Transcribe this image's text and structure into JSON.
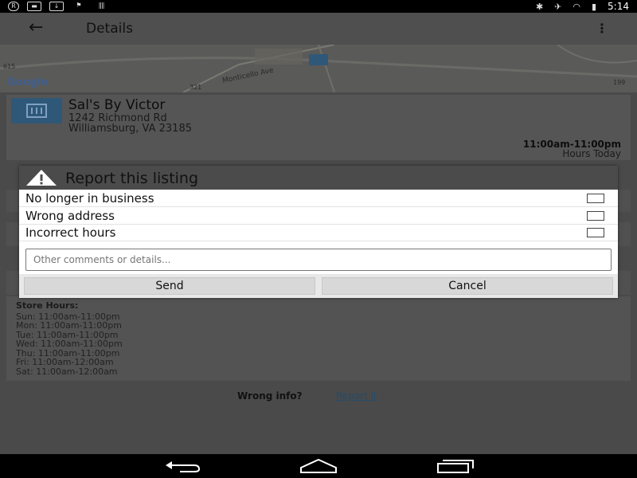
{
  "status_bar": {
    "time": "5:14",
    "icons": [
      "r-badge-icon",
      "message-icon",
      "download-icon",
      "flag-icon",
      "barcode-icon",
      "bluetooth-icon",
      "airplane-icon",
      "wifi-icon",
      "battery-icon"
    ]
  },
  "app_bar": {
    "title": "Details"
  },
  "map": {
    "brand": "Google",
    "road_labels": [
      "Monticello Ave",
      "321",
      "615",
      "199"
    ]
  },
  "listing": {
    "name": "Sal's By Victor",
    "address_line1": "1242 Richmond Rd",
    "address_line2": "Williamsburg, VA 23185",
    "hours": "11:00am-11:00pm",
    "hours_label": "Hours Today"
  },
  "store_hours": {
    "title": "Store Hours:",
    "lines": [
      "Sun: 11:00am-11:00pm",
      "Mon: 11:00am-11:00pm",
      "Tue: 11:00am-11:00pm",
      "Wed: 11:00am-11:00pm",
      "Thu: 11:00am-11:00pm",
      "Fri: 11:00am-12:00am",
      "Sat: 11:00am-12:00am"
    ]
  },
  "footer": {
    "wrong_info": "Wrong info?",
    "report_link": "Report it"
  },
  "dialog": {
    "title": "Report this listing",
    "options": [
      {
        "label": "No longer in business",
        "checked": false
      },
      {
        "label": "Wrong address",
        "checked": false
      },
      {
        "label": "Incorrect hours",
        "checked": false
      }
    ],
    "comments_placeholder": "Other comments or details...",
    "send_label": "Send",
    "cancel_label": "Cancel"
  }
}
